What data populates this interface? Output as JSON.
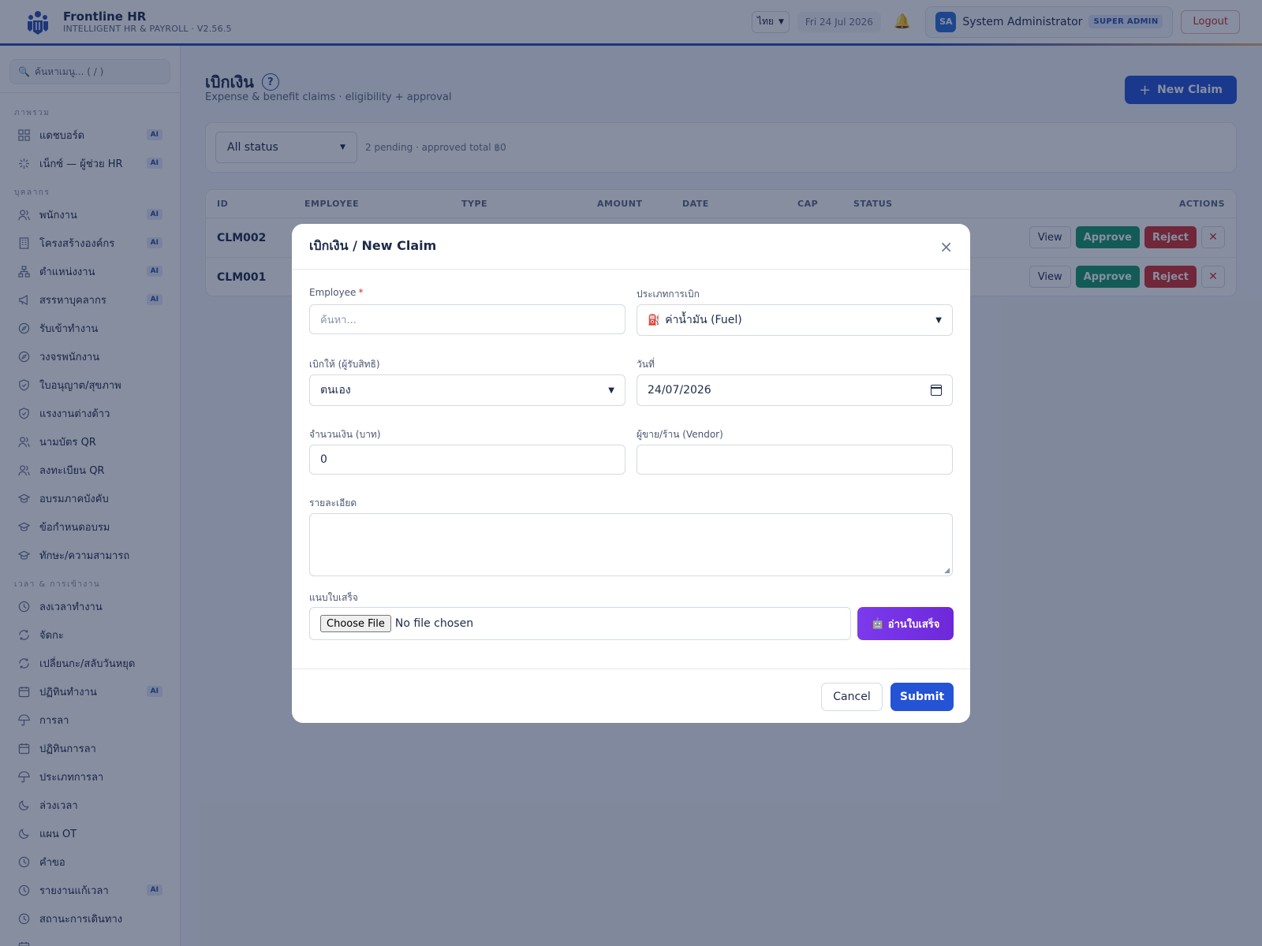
{
  "app": {
    "title": "Frontline HR",
    "subtitle": "INTELLIGENT HR & PAYROLL · V2.56.5"
  },
  "topbar": {
    "language": "ไทย",
    "date": "Fri 24 Jul 2026",
    "user_initials": "SA",
    "user_name": "System Administrator",
    "role": "SUPER ADMIN",
    "logout_label": "Logout"
  },
  "sidebar": {
    "search_placeholder": "ค้นหาเมนู... ( / )",
    "sections": [
      {
        "title": "ภาพรวม",
        "items": [
          {
            "label": "แดชบอร์ด",
            "icon": "grid-icon",
            "ai": "AI"
          },
          {
            "label": "เน็กซ์ — ผู้ช่วย HR",
            "icon": "sparkle-icon",
            "ai": "AI"
          }
        ]
      },
      {
        "title": "บุคลากร",
        "items": [
          {
            "label": "พนักงาน",
            "icon": "users-icon",
            "ai": "AI"
          },
          {
            "label": "โครงสร้างองค์กร",
            "icon": "building-icon",
            "ai": "AI"
          },
          {
            "label": "ตำแหน่งงาน",
            "icon": "org-chart-icon",
            "ai": "AI"
          },
          {
            "label": "สรรหาบุคลากร",
            "icon": "megaphone-icon",
            "ai": "AI"
          },
          {
            "label": "รับเข้าทำงาน",
            "icon": "compass-icon"
          },
          {
            "label": "วงจรพนักงาน",
            "icon": "compass-icon"
          },
          {
            "label": "ใบอนุญาต/สุขภาพ",
            "icon": "shield-icon"
          },
          {
            "label": "แรงงานต่างด้าว",
            "icon": "shield-icon"
          },
          {
            "label": "นามบัตร QR",
            "icon": "users-icon"
          },
          {
            "label": "ลงทะเบียน QR",
            "icon": "users-icon"
          },
          {
            "label": "อบรมภาคบังคับ",
            "icon": "graduation-cap-icon"
          },
          {
            "label": "ข้อกำหนดอบรม",
            "icon": "graduation-cap-icon"
          },
          {
            "label": "ทักษะ/ความสามารถ",
            "icon": "graduation-cap-icon"
          }
        ]
      },
      {
        "title": "เวลา & การเข้างาน",
        "items": [
          {
            "label": "ลงเวลาทำงาน",
            "icon": "clock-icon"
          },
          {
            "label": "จัดกะ",
            "icon": "refresh-icon"
          },
          {
            "label": "เปลี่ยนกะ/สลับวันหยุด",
            "icon": "refresh-icon"
          },
          {
            "label": "ปฏิทินทำงาน",
            "icon": "calendar-icon",
            "ai": "AI"
          },
          {
            "label": "การลา",
            "icon": "umbrella-icon"
          },
          {
            "label": "ปฏิทินการลา",
            "icon": "calendar-icon"
          },
          {
            "label": "ประเภทการลา",
            "icon": "umbrella-icon"
          },
          {
            "label": "ล่วงเวลา",
            "icon": "moon-icon"
          },
          {
            "label": "แผน OT",
            "icon": "moon-icon"
          },
          {
            "label": "คำขอ",
            "icon": "clock-icon"
          },
          {
            "label": "รายงานแก้เวลา",
            "icon": "clock-icon",
            "ai": "AI"
          },
          {
            "label": "สถานะการเดินทาง",
            "icon": "clock-icon"
          },
          {
            "label": "",
            "icon": "calendar-icon"
          }
        ]
      }
    ]
  },
  "page": {
    "title": "เบิกเงิน",
    "subtitle": "Expense & benefit claims · eligibility + approval",
    "new_claim_label": "New Claim",
    "filter_status": "All status",
    "filter_info": "2 pending · approved total ฿0"
  },
  "table": {
    "headers": [
      "ID",
      "EMPLOYEE",
      "TYPE",
      "AMOUNT",
      "DATE",
      "CAP",
      "STATUS",
      "ACTIONS"
    ],
    "rows": [
      {
        "id": "CLM002"
      },
      {
        "id": "CLM001"
      }
    ],
    "actions": {
      "view": "View",
      "approve": "Approve",
      "reject": "Reject",
      "remove": "✕"
    }
  },
  "modal": {
    "title": "เบิกเงิน / New Claim",
    "close": "×",
    "employee_label": "Employee",
    "required_mark": "*",
    "employee_placeholder": "ค้นหา...",
    "claim_type_label": "ประเภทการเบิก",
    "claim_type_value": "ค่าน้ำมัน (Fuel)",
    "beneficiary_label": "เบิกให้ (ผู้รับสิทธิ)",
    "beneficiary_value": "ตนเอง",
    "date_label": "วันที่",
    "date_value": "24/07/2026",
    "amount_label": "จำนวนเงิน (บาท)",
    "amount_value": "0",
    "vendor_label": "ผู้ขาย/ร้าน (Vendor)",
    "vendor_value": "",
    "detail_label": "รายละเอียด",
    "detail_value": "",
    "receipt_label": "แนบใบเสร็จ",
    "choose_file": "Choose File",
    "no_file": "No file chosen",
    "ocr_label": "อ่านใบเสร็จ",
    "cancel_label": "Cancel",
    "submit_label": "Submit"
  }
}
